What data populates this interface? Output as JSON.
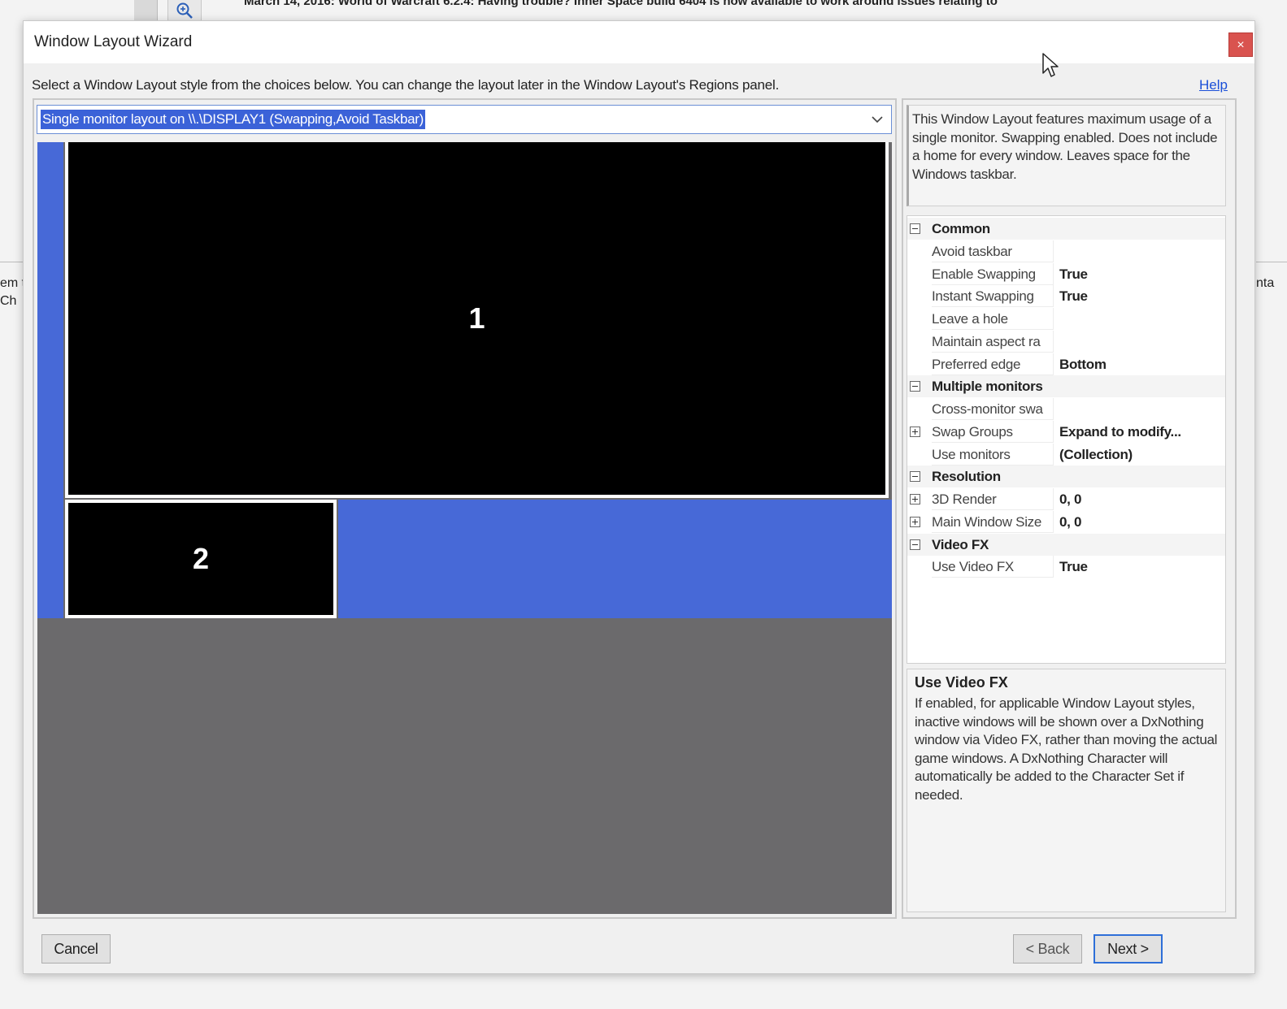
{
  "background": {
    "headline": "March 14, 2016: World of Warcraft 6.2.4: Having trouble? Inner Space build 6404 is now available to work around issues relating to",
    "side_left_lines": [
      "em t",
      " Ch"
    ],
    "side_right_lines": [
      "nta"
    ]
  },
  "dialog": {
    "title": "Window Layout Wizard",
    "close_label": "×",
    "instruction": "Select a Window Layout style from the choices below. You can change the layout later in the Window Layout's Regions panel.",
    "help_label": "Help"
  },
  "layout_select": {
    "selected": "Single monitor layout on \\\\.\\DISPLAY1 (Swapping,Avoid Taskbar)"
  },
  "preview": {
    "regions": [
      {
        "label": "1"
      },
      {
        "label": "2"
      }
    ]
  },
  "description": "This Window Layout features maximum usage of a single monitor. Swapping enabled. Does not include a home for every window. Leaves space for the Windows taskbar.",
  "property_grid": {
    "rows": [
      {
        "type": "category",
        "label": "Common",
        "toggle": "minus"
      },
      {
        "type": "prop",
        "name": "Avoid taskbar",
        "value": ""
      },
      {
        "type": "prop",
        "name": "Enable Swapping",
        "value": "True"
      },
      {
        "type": "prop",
        "name": "Instant Swapping",
        "value": "True"
      },
      {
        "type": "prop",
        "name": "Leave a hole",
        "value": ""
      },
      {
        "type": "prop",
        "name": "Maintain aspect ra",
        "value": ""
      },
      {
        "type": "prop",
        "name": "Preferred edge",
        "value": "Bottom"
      },
      {
        "type": "category",
        "label": "Multiple monitors",
        "toggle": "minus"
      },
      {
        "type": "prop",
        "name": "Cross-monitor swa",
        "value": ""
      },
      {
        "type": "prop",
        "name": "Swap Groups",
        "value": "Expand to modify...",
        "toggle": "plus"
      },
      {
        "type": "prop",
        "name": "Use monitors",
        "value": "(Collection)"
      },
      {
        "type": "category",
        "label": "Resolution",
        "toggle": "minus"
      },
      {
        "type": "prop",
        "name": "3D Render",
        "value": "0, 0",
        "toggle": "plus"
      },
      {
        "type": "prop",
        "name": "Main Window Size",
        "value": "0, 0",
        "toggle": "plus"
      },
      {
        "type": "category",
        "label": "Video FX",
        "toggle": "minus"
      },
      {
        "type": "prop",
        "name": "Use Video FX",
        "value": "True"
      }
    ]
  },
  "help_box": {
    "title": "Use Video FX",
    "text": "If enabled, for applicable Window Layout styles, inactive windows will be shown over a DxNothing window via Video FX, rather than moving the actual game windows. A DxNothing Character will automatically be added to the Character Set if needed."
  },
  "buttons": {
    "cancel": "Cancel",
    "back": "< Back",
    "next": "Next >"
  },
  "colors": {
    "accent_blue": "#4769d7",
    "close_red": "#d9534f",
    "preview_gray": "#6b6a6c"
  }
}
